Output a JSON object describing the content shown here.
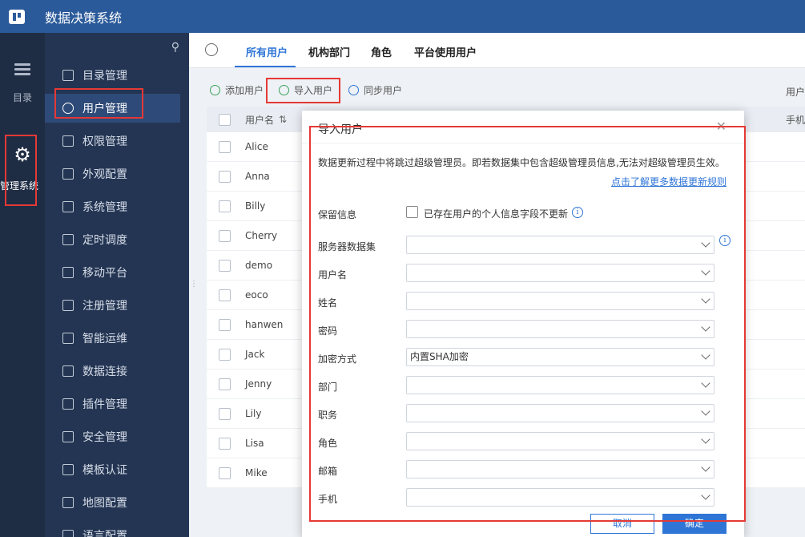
{
  "app": {
    "title": "数据决策系统"
  },
  "rail": {
    "items": [
      {
        "label": "目录",
        "icon": "list-icon"
      },
      {
        "label": "管理系统",
        "icon": "gear-icon"
      }
    ]
  },
  "submenu": {
    "items": [
      {
        "label": "目录管理",
        "icon": "catalog-icon"
      },
      {
        "label": "用户管理",
        "icon": "user-icon",
        "active": true
      },
      {
        "label": "权限管理",
        "icon": "lock-icon"
      },
      {
        "label": "外观配置",
        "icon": "brush-icon"
      },
      {
        "label": "系统管理",
        "icon": "gear-icon"
      },
      {
        "label": "定时调度",
        "icon": "clock-icon"
      },
      {
        "label": "移动平台",
        "icon": "mobile-icon"
      },
      {
        "label": "注册管理",
        "icon": "register-icon"
      },
      {
        "label": "智能运维",
        "icon": "network-icon"
      },
      {
        "label": "数据连接",
        "icon": "link-icon"
      },
      {
        "label": "插件管理",
        "icon": "plugin-icon"
      },
      {
        "label": "安全管理",
        "icon": "shield-icon"
      },
      {
        "label": "模板认证",
        "icon": "template-icon"
      },
      {
        "label": "地图配置",
        "icon": "map-icon"
      },
      {
        "label": "语言配置",
        "icon": "globe-icon"
      }
    ]
  },
  "tabs": [
    {
      "label": "所有用户",
      "active": true
    },
    {
      "label": "机构部门"
    },
    {
      "label": "角色"
    },
    {
      "label": "平台使用用户"
    }
  ],
  "toolbar": {
    "add": "添加用户",
    "import": "导入用户",
    "sync": "同步用户",
    "right": "用户"
  },
  "table": {
    "header_name": "用户名",
    "header_right": "手机",
    "rows": [
      "Alice",
      "Anna",
      "Billy",
      "Cherry",
      "demo",
      "eoco",
      "hanwen",
      "Jack",
      "Jenny",
      "Lily",
      "Lisa",
      "Mike"
    ]
  },
  "dialog": {
    "title": "导入用户",
    "note": "数据更新过程中将跳过超级管理员。即若数据集中包含超级管理员信息,无法对超级管理员生效。",
    "link": "点击了解更多数据更新规则",
    "keep_label": "保留信息",
    "keep_text": "已存在用户的个人信息字段不更新",
    "fields": [
      {
        "label": "服务器数据集",
        "value": ""
      },
      {
        "label": "用户名",
        "value": ""
      },
      {
        "label": "姓名",
        "value": ""
      },
      {
        "label": "密码",
        "value": ""
      },
      {
        "label": "加密方式",
        "value": "内置SHA加密"
      },
      {
        "label": "部门",
        "value": ""
      },
      {
        "label": "职务",
        "value": ""
      },
      {
        "label": "角色",
        "value": ""
      },
      {
        "label": "邮箱",
        "value": ""
      },
      {
        "label": "手机",
        "value": ""
      }
    ],
    "cancel": "取消",
    "ok": "确定"
  }
}
